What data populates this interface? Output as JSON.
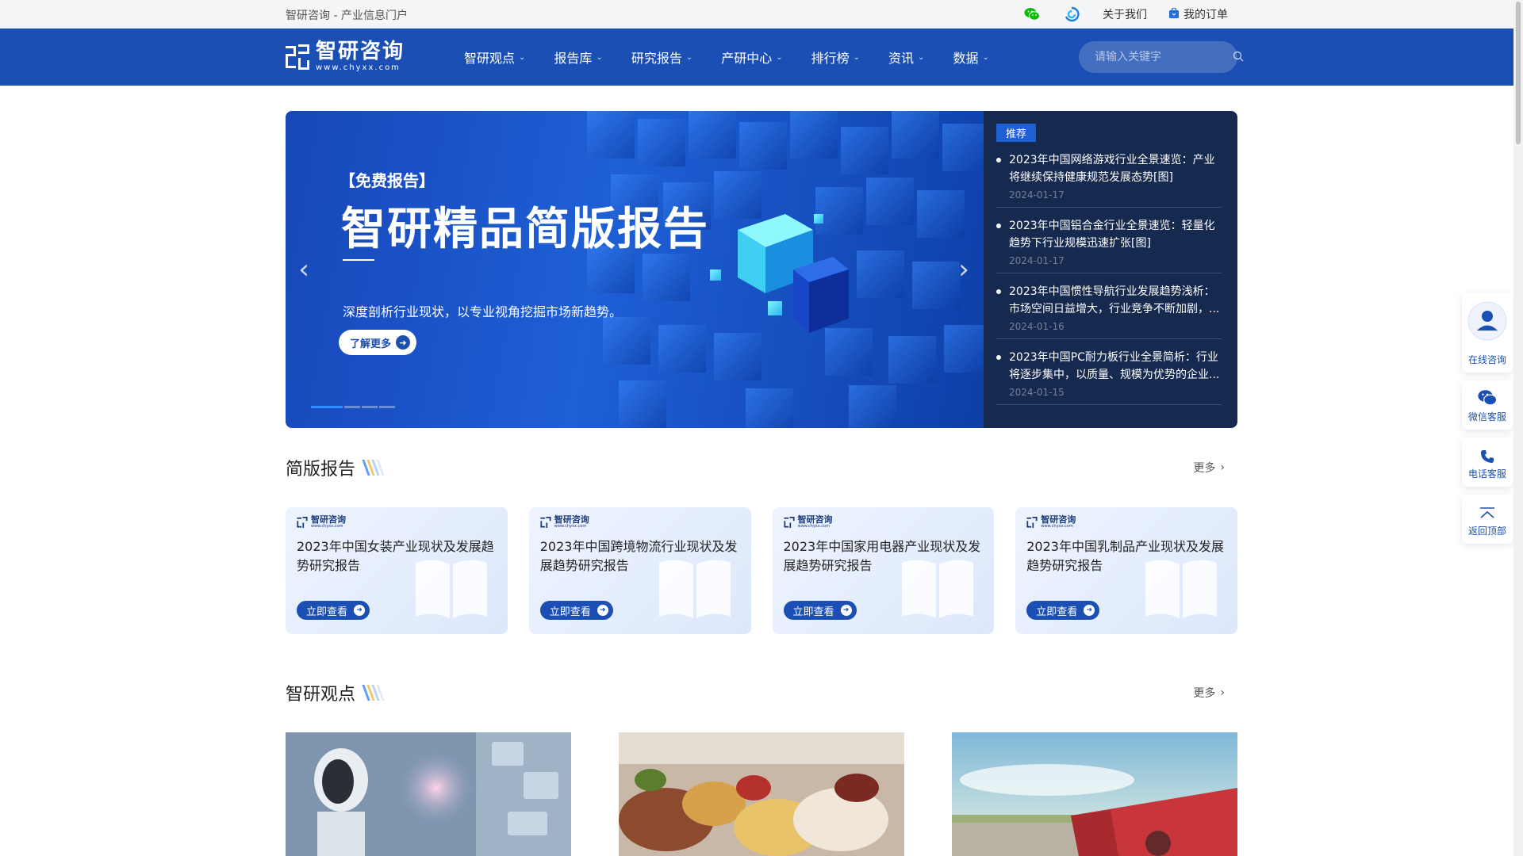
{
  "topbar": {
    "tagline": "智研咨询 - 产业信息门户",
    "links": [
      {
        "label": "关于我们"
      },
      {
        "label": "我的订单"
      }
    ]
  },
  "logo": {
    "name": "智研咨询",
    "url_text": "www.chyxx.com"
  },
  "nav": {
    "items": [
      {
        "label": "智研观点"
      },
      {
        "label": "报告库"
      },
      {
        "label": "研究报告"
      },
      {
        "label": "产研中心"
      },
      {
        "label": "排行榜"
      },
      {
        "label": "资讯"
      },
      {
        "label": "数据"
      }
    ],
    "search_placeholder": "请输入关键字"
  },
  "hero": {
    "tag": "【免费报告】",
    "title": "智研精品简版报告",
    "description": "深度剖析行业现状，以专业视角挖掘市场新趋势。",
    "button_label": "了解更多",
    "prev_glyph": "‹",
    "next_glyph": "›",
    "slide_count": 4,
    "active_slide": 1
  },
  "recommend": {
    "tag": "推荐",
    "items": [
      {
        "title": "2023年中国网络游戏行业全景速览：产业将继续保持健康规范发展态势[图]",
        "date": "2024-01-17"
      },
      {
        "title": "2023年中国铝合金行业全景速览：轻量化趋势下行业规模迅速扩张[图]",
        "date": "2024-01-17"
      },
      {
        "title": "2023年中国惯性导航行业发展趋势浅析：市场空间日益增大，行业竞争不断加剧，...",
        "date": "2024-01-16"
      },
      {
        "title": "2023年中国PC耐力板行业全景简析：行业将逐步集中，以质量、规模为优势的企业...",
        "date": "2024-01-15"
      }
    ]
  },
  "brief_section": {
    "title": "简版报告",
    "more_label": "更多",
    "cards": [
      {
        "title": "2023年中国女装产业现状及发展趋势研究报告",
        "button_label": "立即查看"
      },
      {
        "title": "2023年中国跨境物流行业现状及发展趋势研究报告",
        "button_label": "立即查看"
      },
      {
        "title": "2023年中国家用电器产业现状及发展趋势研究报告",
        "button_label": "立即查看"
      },
      {
        "title": "2023年中国乳制品产业现状及发展趋势研究报告",
        "button_label": "立即查看"
      }
    ]
  },
  "views_section": {
    "title": "智研观点",
    "more_label": "更多"
  },
  "float_bar": {
    "items": [
      {
        "label": "在线咨询"
      },
      {
        "label": "微信客服"
      },
      {
        "label": "电话客服"
      },
      {
        "label": "返回顶部"
      }
    ]
  },
  "colors": {
    "brand_blue": "#1b4fb3",
    "hero_side_bg": "#16294f",
    "wechat_green": "#09bb07"
  }
}
